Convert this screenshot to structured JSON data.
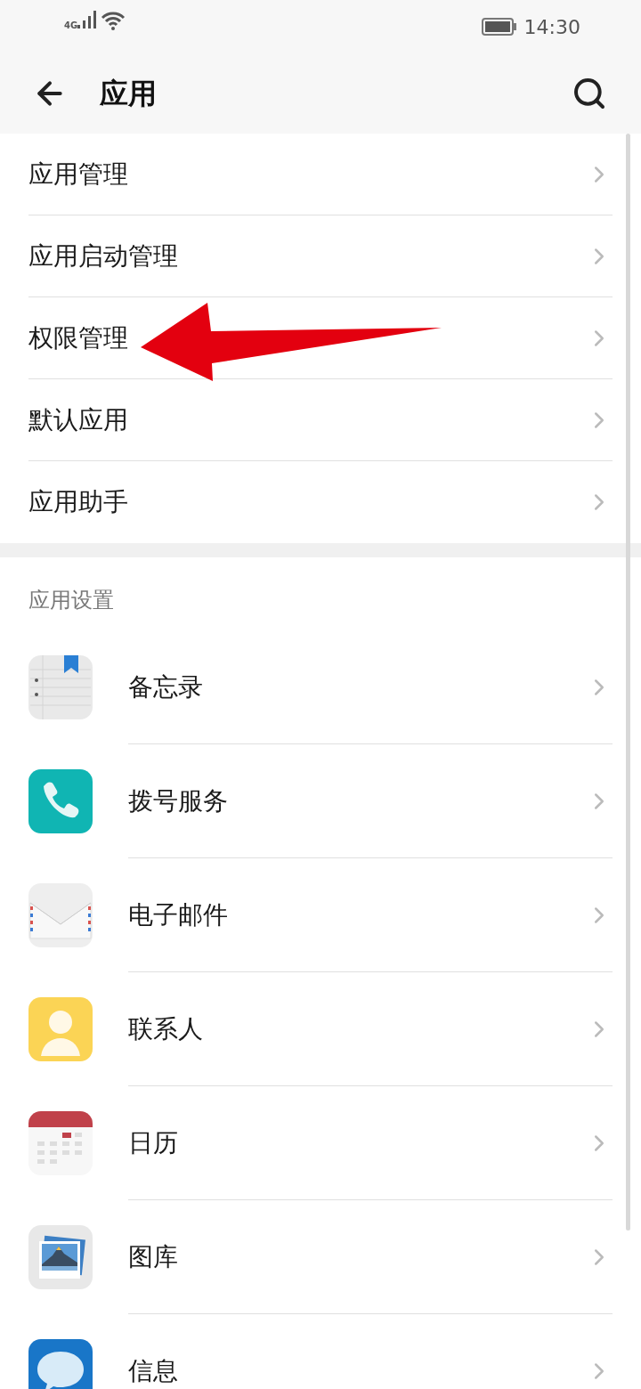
{
  "status_bar": {
    "network": "4G",
    "time": "14:30"
  },
  "header": {
    "title": "应用"
  },
  "menu_items": [
    {
      "label": "应用管理"
    },
    {
      "label": "应用启动管理"
    },
    {
      "label": "权限管理"
    },
    {
      "label": "默认应用"
    },
    {
      "label": "应用助手"
    }
  ],
  "app_settings": {
    "heading": "应用设置",
    "apps": [
      {
        "label": "备忘录",
        "kind": "notes"
      },
      {
        "label": "拨号服务",
        "kind": "phone"
      },
      {
        "label": "电子邮件",
        "kind": "mail"
      },
      {
        "label": "联系人",
        "kind": "contact"
      },
      {
        "label": "日历",
        "kind": "calendar"
      },
      {
        "label": "图库",
        "kind": "gallery"
      },
      {
        "label": "信息",
        "kind": "message"
      }
    ]
  }
}
